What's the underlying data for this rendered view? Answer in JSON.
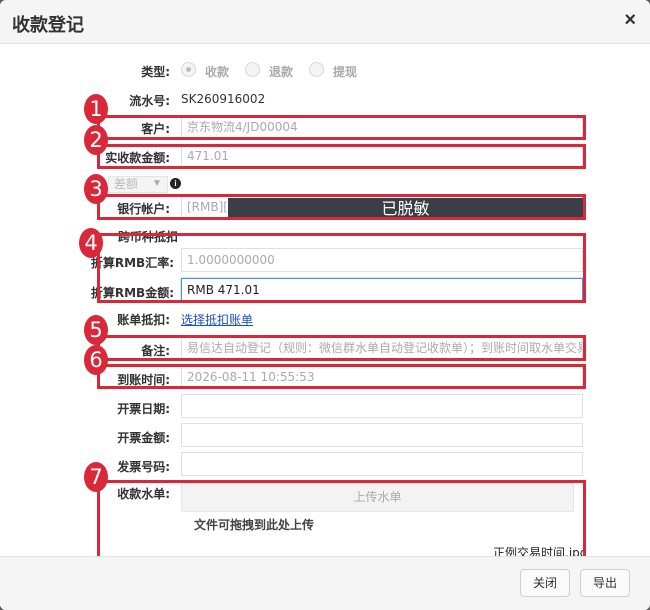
{
  "dialog": {
    "title": "收款登记",
    "close_icon": "×"
  },
  "form": {
    "type_label": "类型:",
    "type_options": [
      {
        "label": "收款",
        "checked": true
      },
      {
        "label": "退款",
        "checked": false
      },
      {
        "label": "提现",
        "checked": false
      }
    ],
    "serial_label": "流水号:",
    "serial_value": "SK260916002",
    "customer_label": "客户:",
    "customer_value": "京东物流4/JD00004",
    "amount_label": "实收款金额:",
    "amount_value": "471.01",
    "diff_select": "差额",
    "bank_label": "银行帐户:",
    "bank_value": "[RMB][中",
    "bank_mask": "已脱敏",
    "cross_currency_label": "跨币种抵扣",
    "rate_label": "折算RMB汇率:",
    "rate_value": "1.0000000000",
    "rmb_amount_label": "折算RMB金额:",
    "rmb_amount_value": "RMB 471.01",
    "offset_label": "账单抵扣:",
    "offset_link": "选择抵扣账单",
    "remark_label": "备注:",
    "remark_value": "易信达自动登记（规则：微信群水单自动登记收款单）；到账时间取水单交易时间",
    "arrival_label": "到账时间:",
    "arrival_value": "2026-08-11 10:55:53",
    "invoice_date_label": "开票日期:",
    "invoice_amount_label": "开票金额:",
    "invoice_no_label": "发票号码:",
    "receipt_label": "收款水单:",
    "upload_button": "上传水单",
    "drag_hint": "文件可拖拽到此处上传",
    "attached_file": "正例交易时间.jpg"
  },
  "annotations": [
    "1",
    "2",
    "3",
    "4",
    "5",
    "6",
    "7"
  ],
  "footer": {
    "close_button": "关闭",
    "export_button": "导出"
  },
  "colors": {
    "annotation_red": "#d8283a",
    "mask_bg": "#3a3f47",
    "link_blue": "#1a4fcf",
    "focus_border": "#4a90e2"
  }
}
